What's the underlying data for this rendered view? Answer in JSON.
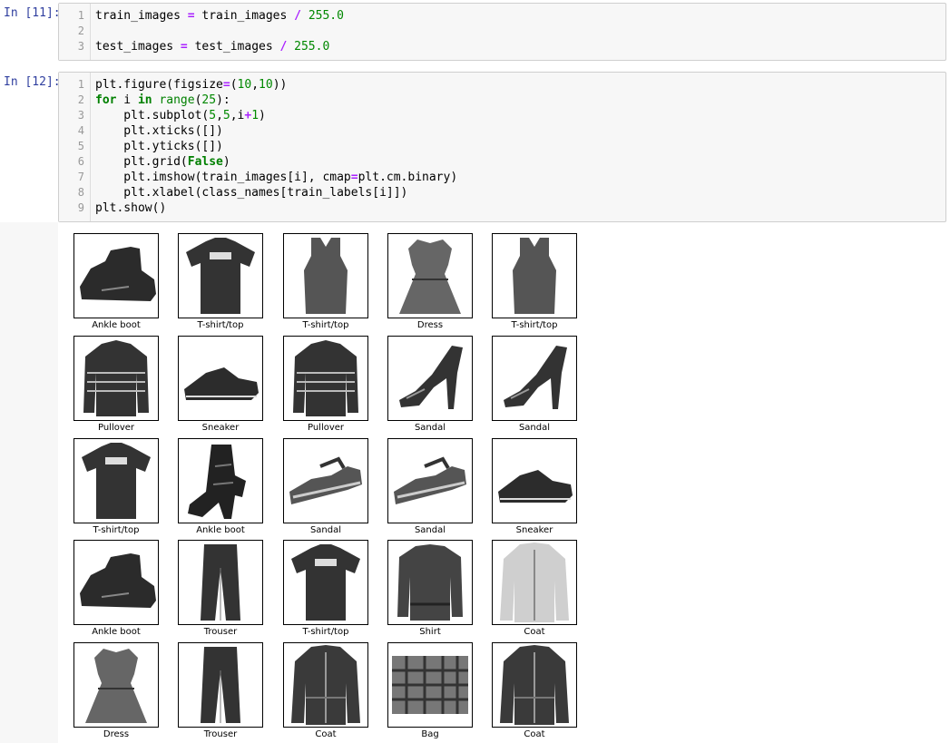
{
  "cells": [
    {
      "prompt": "In [11]:",
      "lines": [
        {
          "n": "1",
          "html": "train_images <span class=\"op\">=</span> train_images <span class=\"op\">/</span> <span class=\"num\">255.0</span>"
        },
        {
          "n": "2",
          "html": ""
        },
        {
          "n": "3",
          "html": "test_images <span class=\"op\">=</span> test_images <span class=\"op\">/</span> <span class=\"num\">255.0</span>"
        }
      ]
    },
    {
      "prompt": "In [12]:",
      "lines": [
        {
          "n": "1",
          "html": "plt.figure(figsize<span class=\"op\">=</span>(<span class=\"num\">10</span>,<span class=\"num\">10</span>))"
        },
        {
          "n": "2",
          "html": "<span class=\"kw\">for</span> i <span class=\"kw\">in</span> <span class=\"bi\">range</span>(<span class=\"num\">25</span>):"
        },
        {
          "n": "3",
          "html": "    plt.subplot(<span class=\"num\">5</span>,<span class=\"num\">5</span>,i<span class=\"op\">+</span><span class=\"num\">1</span>)"
        },
        {
          "n": "4",
          "html": "    plt.xticks([])"
        },
        {
          "n": "5",
          "html": "    plt.yticks([])"
        },
        {
          "n": "6",
          "html": "    plt.grid(<span class=\"kw\">False</span>)"
        },
        {
          "n": "7",
          "html": "    plt.imshow(train_images[i], cmap<span class=\"op\">=</span>plt.cm.binary)"
        },
        {
          "n": "8",
          "html": "    plt.xlabel(class_names[train_labels[i]])"
        },
        {
          "n": "9",
          "html": "plt.show()"
        }
      ]
    }
  ],
  "figure": {
    "labels": [
      "Ankle boot",
      "T-shirt/top",
      "T-shirt/top",
      "Dress",
      "T-shirt/top",
      "Pullover",
      "Sneaker",
      "Pullover",
      "Sandal",
      "Sandal",
      "T-shirt/top",
      "Ankle boot",
      "Sandal",
      "Sandal",
      "Sneaker",
      "Ankle boot",
      "Trouser",
      "T-shirt/top",
      "Shirt",
      "Coat",
      "Dress",
      "Trouser",
      "Coat",
      "Bag",
      "Coat"
    ],
    "shapes": [
      "boot",
      "tshirt",
      "tank",
      "dress",
      "tank",
      "pullover",
      "sneaker",
      "pullover",
      "sandal",
      "sandal",
      "tshirt",
      "boot-tall",
      "sandal-flat",
      "sandal-flat",
      "sneaker",
      "boot",
      "trouser",
      "tshirt",
      "shirt",
      "coat-light",
      "dress",
      "trouser",
      "coat",
      "bag",
      "coat"
    ]
  }
}
